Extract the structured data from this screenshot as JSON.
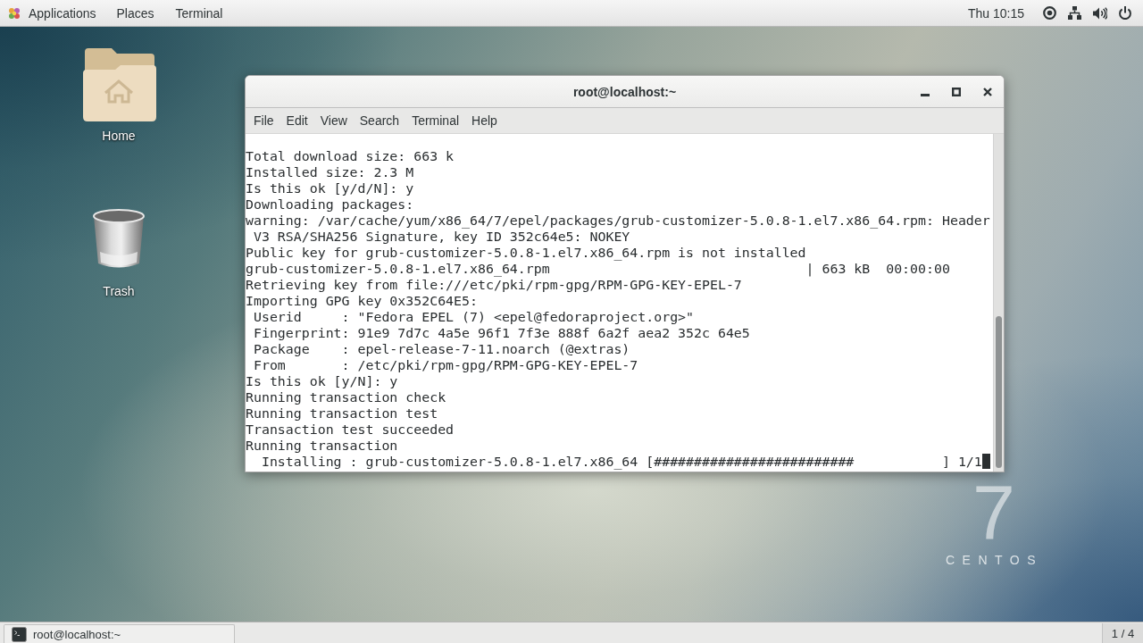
{
  "top_bar": {
    "menus": [
      {
        "label": "Applications",
        "kind": "apps"
      },
      {
        "label": "Places",
        "kind": "plain"
      },
      {
        "label": "Terminal",
        "kind": "plain"
      }
    ],
    "clock": "Thu 10:15"
  },
  "desktop": {
    "wallpaper": {
      "logo_number": "7",
      "logo_text": "CENTOS"
    },
    "icons": [
      {
        "label": "Home",
        "kind": "home"
      },
      {
        "label": "Trash",
        "kind": "trash"
      }
    ]
  },
  "window": {
    "title": "root@localhost:~",
    "menu": [
      "File",
      "Edit",
      "View",
      "Search",
      "Terminal",
      "Help"
    ],
    "terminal": {
      "lines": [
        "Total download size: 663 k",
        "Installed size: 2.3 M",
        "Is this ok [y/d/N]: y",
        "Downloading packages:",
        "warning: /var/cache/yum/x86_64/7/epel/packages/grub-customizer-5.0.8-1.el7.x86_64.rpm: Header",
        " V3 RSA/SHA256 Signature, key ID 352c64e5: NOKEY",
        "Public key for grub-customizer-5.0.8-1.el7.x86_64.rpm is not installed",
        "grub-customizer-5.0.8-1.el7.x86_64.rpm                                | 663 kB  00:00:00",
        "Retrieving key from file:///etc/pki/rpm-gpg/RPM-GPG-KEY-EPEL-7",
        "Importing GPG key 0x352C64E5:",
        " Userid     : \"Fedora EPEL (7) <epel@fedoraproject.org>\"",
        " Fingerprint: 91e9 7d7c 4a5e 96f1 7f3e 888f 6a2f aea2 352c 64e5",
        " Package    : epel-release-7-11.noarch (@extras)",
        " From       : /etc/pki/rpm-gpg/RPM-GPG-KEY-EPEL-7",
        "Is this ok [y/N]: y",
        "Running transaction check",
        "Running transaction test",
        "Transaction test succeeded",
        "Running transaction",
        "  Installing : grub-customizer-5.0.8-1.el7.x86_64 [#########################           ] 1/1"
      ],
      "cursor": true
    }
  },
  "taskbar": {
    "windows": [
      {
        "title": "root@localhost:~"
      }
    ],
    "workspace": "1 / 4"
  }
}
